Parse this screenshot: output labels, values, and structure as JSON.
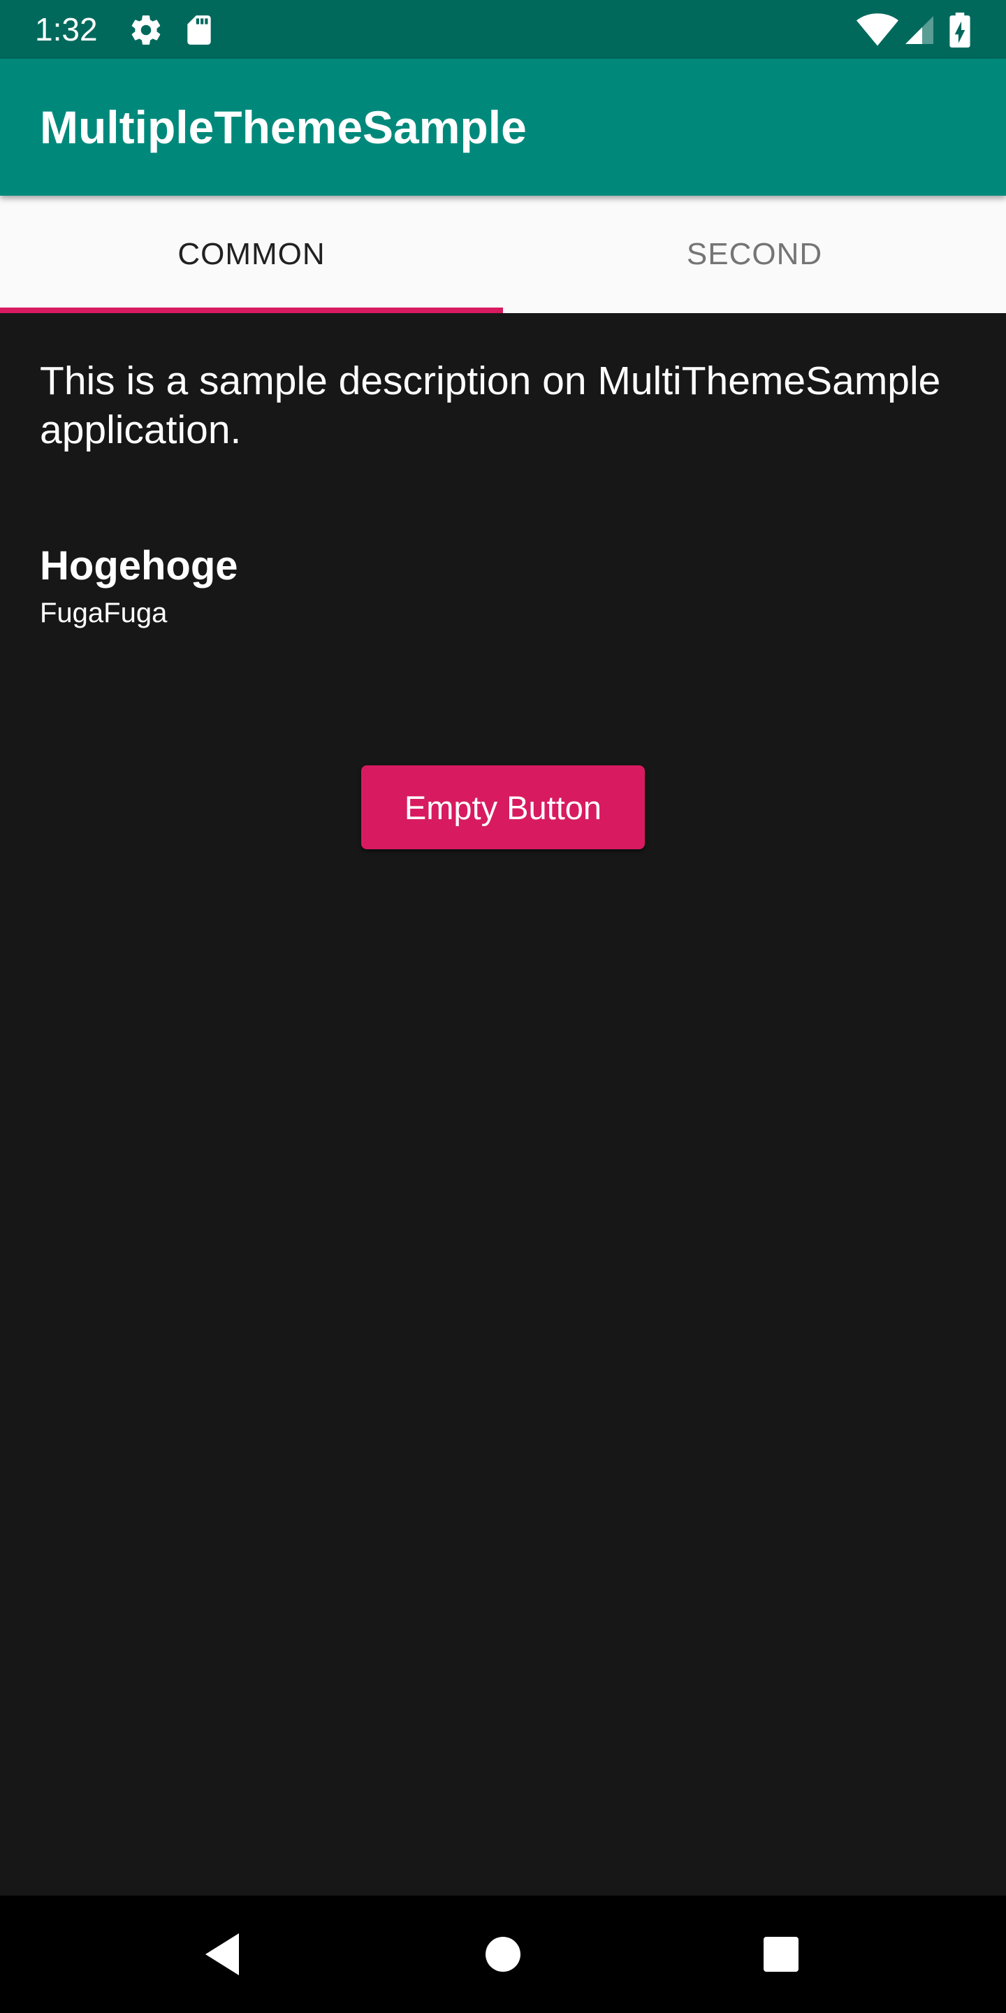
{
  "status_bar": {
    "time": "1:32",
    "icons": [
      "gear-icon",
      "sd-card-icon",
      "wifi-icon",
      "cell-signal-icon",
      "battery-charging-icon"
    ],
    "background": "#00695c"
  },
  "app_bar": {
    "title": "MultipleThemeSample",
    "background": "#00897b"
  },
  "tabs": [
    {
      "label": "COMMON",
      "selected": true
    },
    {
      "label": "SECOND",
      "selected": false
    }
  ],
  "accent_color": "#d81b60",
  "content": {
    "description": "This is a sample description on MultiThemeSample application.",
    "item_title": "Hogehoge",
    "item_subtitle": "FugaFuga",
    "button_label": "Empty Button",
    "background": "#171717"
  },
  "nav_bar": {
    "icons": [
      "back-icon",
      "home-icon",
      "recents-icon"
    ]
  }
}
